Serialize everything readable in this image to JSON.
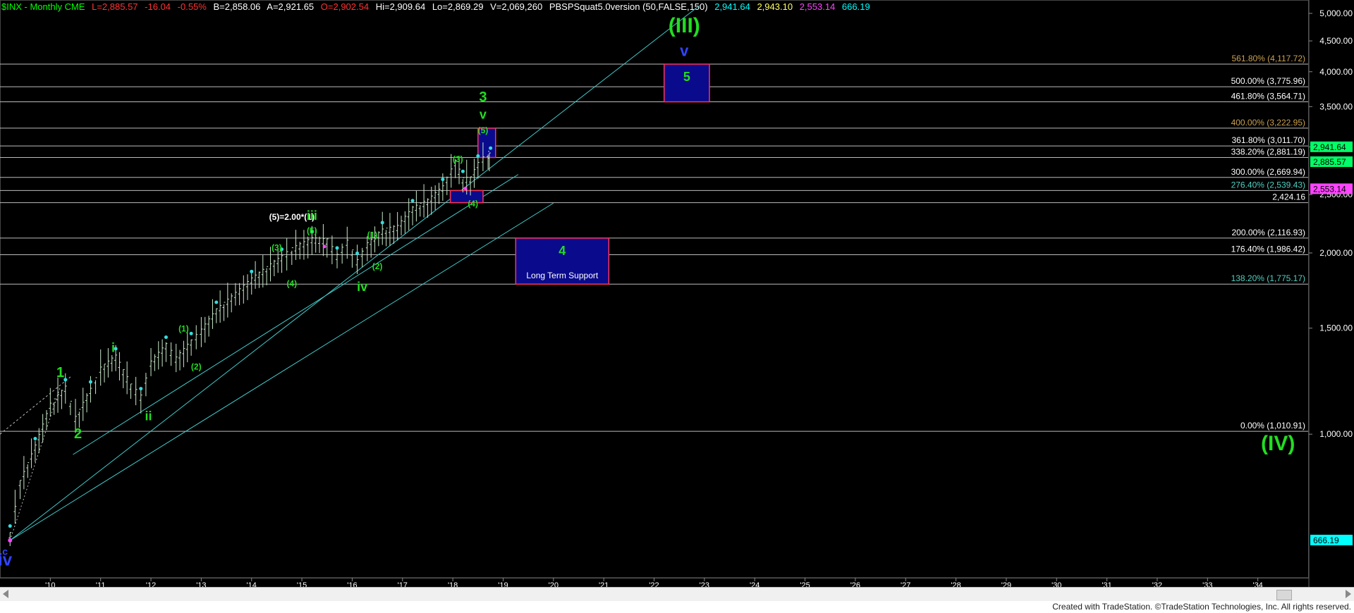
{
  "header": {
    "symbol": "$INX - Monthly  CME",
    "last": "L=2,885.57",
    "change": "-16.04",
    "change_pct": "-0.55%",
    "bid": "B=2,858.06",
    "ask": "A=2,921.65",
    "open": "O=2,902.54",
    "high": "Hi=2,909.64",
    "low": "Lo=2,869.29",
    "volume": "V=2,069,260",
    "study": "PBSPSquat5.0version (50,FALSE,150)",
    "study_v1": "2,941.64",
    "study_v2": "2,943.10",
    "study_v3": "2,553.14",
    "study_v4": "666.19",
    "colors": {
      "symbol": "#00ff00",
      "negative": "#ff3333",
      "neutral": "#ffffff",
      "open": "#ff3333",
      "v1": "#00ffff",
      "v2": "#ffff66",
      "v3": "#ff44ff",
      "v4": "#00ffff"
    }
  },
  "chart_data": {
    "type": "line",
    "title": "$INX - Monthly",
    "scale": "log",
    "ylim": [
      590,
      5150
    ],
    "x_ticks": [
      "'10",
      "'11",
      "'12",
      "'13",
      "'14",
      "'15",
      "'16",
      "'17",
      "'18",
      "'19",
      "'20",
      "'21",
      "'22",
      "'23",
      "'24",
      "'25",
      "'26",
      "'27",
      "'28",
      "'29",
      "'30",
      "'31",
      "'32",
      "'33",
      "'34"
    ],
    "y_ticks": [
      "5,000.00",
      "4,500.00",
      "4,000.00",
      "3,500.00",
      "3,000.00",
      "2,500.00",
      "2,000.00",
      "1,500.00",
      "1,000.00"
    ],
    "y_tick_values": [
      5000,
      4500,
      4000,
      3500,
      3000,
      2500,
      2000,
      1500,
      1000
    ],
    "price_series": [
      {
        "x": 2009.2,
        "y": 680
      },
      {
        "x": 2009.4,
        "y": 830
      },
      {
        "x": 2009.7,
        "y": 950
      },
      {
        "x": 2010.0,
        "y": 1115
      },
      {
        "x": 2010.3,
        "y": 1190
      },
      {
        "x": 2010.5,
        "y": 1060
      },
      {
        "x": 2010.8,
        "y": 1180
      },
      {
        "x": 2011.0,
        "y": 1280
      },
      {
        "x": 2011.3,
        "y": 1340
      },
      {
        "x": 2011.6,
        "y": 1200
      },
      {
        "x": 2011.8,
        "y": 1150
      },
      {
        "x": 2012.0,
        "y": 1310
      },
      {
        "x": 2012.3,
        "y": 1400
      },
      {
        "x": 2012.5,
        "y": 1330
      },
      {
        "x": 2012.8,
        "y": 1420
      },
      {
        "x": 2013.0,
        "y": 1480
      },
      {
        "x": 2013.3,
        "y": 1600
      },
      {
        "x": 2013.6,
        "y": 1680
      },
      {
        "x": 2014.0,
        "y": 1800
      },
      {
        "x": 2014.3,
        "y": 1880
      },
      {
        "x": 2014.6,
        "y": 1960
      },
      {
        "x": 2014.8,
        "y": 2020
      },
      {
        "x": 2015.2,
        "y": 2100
      },
      {
        "x": 2015.5,
        "y": 2090
      },
      {
        "x": 2015.7,
        "y": 1970
      },
      {
        "x": 2015.9,
        "y": 2080
      },
      {
        "x": 2016.1,
        "y": 1930
      },
      {
        "x": 2016.3,
        "y": 2060
      },
      {
        "x": 2016.6,
        "y": 2170
      },
      {
        "x": 2016.9,
        "y": 2200
      },
      {
        "x": 2017.2,
        "y": 2360
      },
      {
        "x": 2017.5,
        "y": 2430
      },
      {
        "x": 2017.8,
        "y": 2560
      },
      {
        "x": 2018.05,
        "y": 2820
      },
      {
        "x": 2018.2,
        "y": 2640
      },
      {
        "x": 2018.35,
        "y": 2650
      },
      {
        "x": 2018.5,
        "y": 2800
      },
      {
        "x": 2018.7,
        "y": 2920
      },
      {
        "x": 2018.75,
        "y": 2885.57
      }
    ],
    "fib_levels": [
      {
        "pct": "561.80%",
        "value": "(4,117.72)",
        "price": 4117.72,
        "color": "#c8a050"
      },
      {
        "pct": "500.00%",
        "value": "(3,775.96)",
        "price": 3775.96,
        "color": "#ffffff"
      },
      {
        "pct": "461.80%",
        "value": "(3,564.71)",
        "price": 3564.71,
        "color": "#ffffff"
      },
      {
        "pct": "400.00%",
        "value": "(3,222.95)",
        "price": 3222.95,
        "color": "#c8a050"
      },
      {
        "pct": "361.80%",
        "value": "(3,011.70)",
        "price": 3011.7,
        "color": "#ffffff"
      },
      {
        "pct": "338.20%",
        "value": "(2,881.19)",
        "price": 2881.19,
        "color": "#ffffff"
      },
      {
        "pct": "300.00%",
        "value": "(2,669.94)",
        "price": 2669.94,
        "color": "#ffffff"
      },
      {
        "pct": "276.40%",
        "value": "(2,539.43)",
        "price": 2539.43,
        "color": "#50d0c0"
      },
      {
        "pct": "",
        "value": "2,424.16",
        "price": 2424.16,
        "color": "#ffffff"
      },
      {
        "pct": "200.00%",
        "value": "(2,116.93)",
        "price": 2116.93,
        "color": "#ffffff"
      },
      {
        "pct": "176.40%",
        "value": "(1,986.42)",
        "price": 1986.42,
        "color": "#ffffff"
      },
      {
        "pct": "138.20%",
        "value": "(1,775.17)",
        "price": 1775.17,
        "color": "#50d0c0"
      },
      {
        "pct": "0.00%",
        "value": "(1,010.91)",
        "price": 1010.91,
        "color": "#ffffff"
      }
    ],
    "axis_badges": [
      {
        "text": "2,941.64",
        "price": 2941.64,
        "color": "#00ff66"
      },
      {
        "text": "2,885.57",
        "price": 2885.57,
        "color": "#00ff66"
      },
      {
        "text": "2,553.14",
        "price": 2553.14,
        "color": "#ff44ff"
      },
      {
        "text": "666.19",
        "price": 666.19,
        "color": "#00ffff"
      }
    ],
    "target_boxes": [
      {
        "label": "5",
        "x0": 2022.2,
        "x1": 2023.1,
        "y0": 3564.71,
        "y1": 4117.72
      },
      {
        "label": "4",
        "sublabel": "Long Term Support",
        "x0": 2019.25,
        "x1": 2021.1,
        "y0": 1775.17,
        "y1": 2116.93
      },
      {
        "label": "",
        "x0": 2018.5,
        "x1": 2018.85,
        "y0": 2881.19,
        "y1": 3222.95
      },
      {
        "label": "",
        "x0": 2017.95,
        "x1": 2018.6,
        "y0": 2424.16,
        "y1": 2539.43
      }
    ],
    "wave_labels": [
      {
        "text": "(III)",
        "x": 2022.6,
        "y": 4650,
        "color": "#22dd22",
        "size": 30
      },
      {
        "text": "v",
        "x": 2022.6,
        "y": 4250,
        "color": "#3344ff",
        "size": 22
      },
      {
        "text": "(IV)",
        "x": 2034.4,
        "y": 940,
        "color": "#22dd22",
        "size": 30
      },
      {
        "text": "iv",
        "x": 2009.1,
        "y": 605,
        "color": "#3344ff",
        "size": 24
      },
      {
        "text": "c",
        "x": 2009.1,
        "y": 630,
        "color": "#3344ff",
        "size": 14
      },
      {
        "text": "3",
        "x": 2018.6,
        "y": 3570,
        "color": "#22dd22",
        "size": 20
      },
      {
        "text": "v",
        "x": 2018.6,
        "y": 3340,
        "color": "#22dd22",
        "size": 18
      },
      {
        "text": "(5)",
        "x": 2018.6,
        "y": 3160,
        "color": "#22dd22",
        "size": 12
      },
      {
        "text": "(3)",
        "x": 2018.1,
        "y": 2830,
        "color": "#22dd22",
        "size": 12
      },
      {
        "text": "(4)",
        "x": 2018.4,
        "y": 2390,
        "color": "#22dd22",
        "size": 12
      },
      {
        "text": "(5)=2.00*(1)",
        "x": 2014.8,
        "y": 2270,
        "color": "#ffffff",
        "size": 12
      },
      {
        "text": "iii",
        "x": 2015.2,
        "y": 2270,
        "color": "#22dd22",
        "size": 18
      },
      {
        "text": "(5)",
        "x": 2015.2,
        "y": 2155,
        "color": "#22dd22",
        "size": 12
      },
      {
        "text": "(3)",
        "x": 2014.5,
        "y": 2020,
        "color": "#22dd22",
        "size": 12
      },
      {
        "text": "(4)",
        "x": 2014.8,
        "y": 1760,
        "color": "#22dd22",
        "size": 12
      },
      {
        "text": "(1)",
        "x": 2016.4,
        "y": 2120,
        "color": "#22dd22",
        "size": 12
      },
      {
        "text": "(2)",
        "x": 2016.5,
        "y": 1880,
        "color": "#22dd22",
        "size": 12
      },
      {
        "text": "iv",
        "x": 2016.2,
        "y": 1730,
        "color": "#22dd22",
        "size": 18
      },
      {
        "text": "(1)",
        "x": 2012.65,
        "y": 1480,
        "color": "#22dd22",
        "size": 12
      },
      {
        "text": "(2)",
        "x": 2012.9,
        "y": 1280,
        "color": "#22dd22",
        "size": 12
      },
      {
        "text": "i",
        "x": 2011.25,
        "y": 1370,
        "color": "#22dd22",
        "size": 18
      },
      {
        "text": "ii",
        "x": 2011.95,
        "y": 1055,
        "color": "#22dd22",
        "size": 18
      },
      {
        "text": "1",
        "x": 2010.2,
        "y": 1245,
        "color": "#22dd22",
        "size": 20
      },
      {
        "text": "2",
        "x": 2010.55,
        "y": 985,
        "color": "#22dd22",
        "size": 20
      }
    ],
    "channel_lines": [
      {
        "x0": 2009.2,
        "y0": 666.19,
        "x1": 2022.9,
        "y1": 5150
      },
      {
        "x0": 2010.45,
        "y0": 925,
        "x1": 2019.3,
        "y1": 2700
      },
      {
        "x0": 2009.2,
        "y0": 666.19,
        "x1": 2020.0,
        "y1": 2420
      },
      {
        "x0": 2009.0,
        "y0": 1000,
        "x1": 2010.4,
        "y1": 1245
      }
    ],
    "grid": false,
    "legend": "none"
  },
  "footer": {
    "credit": "Created with TradeStation. ©TradeStation Technologies, Inc. All rights reserved."
  }
}
